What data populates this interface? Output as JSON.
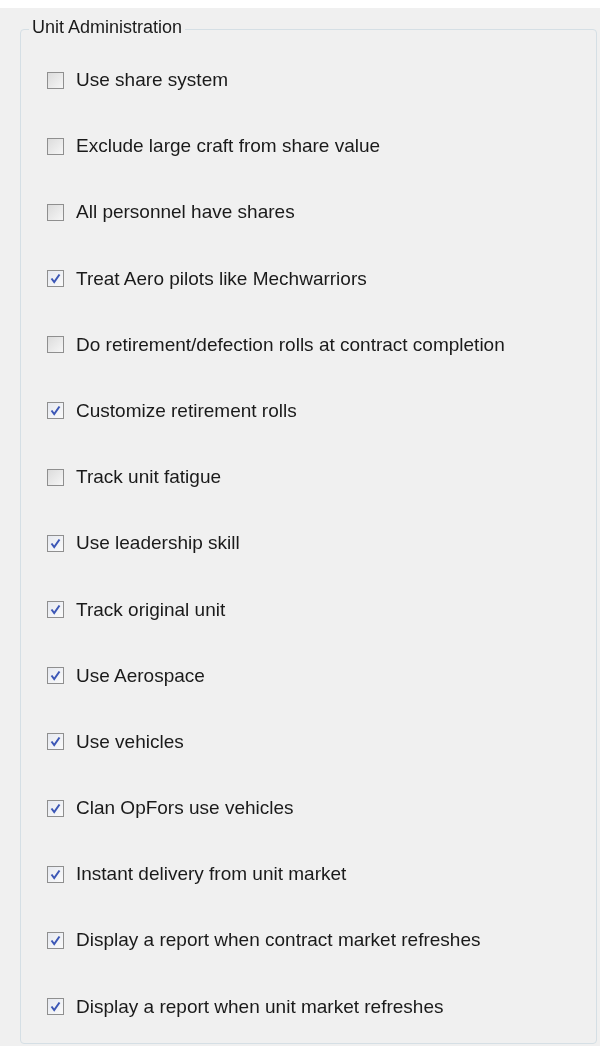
{
  "group": {
    "title": "Unit Administration",
    "options": [
      {
        "label": "Use share system",
        "checked": false
      },
      {
        "label": "Exclude large craft from share value",
        "checked": false
      },
      {
        "label": "All personnel have shares",
        "checked": false
      },
      {
        "label": "Treat Aero pilots like Mechwarriors",
        "checked": true
      },
      {
        "label": "Do retirement/defection rolls at contract completion",
        "checked": false
      },
      {
        "label": "Customize retirement rolls",
        "checked": true
      },
      {
        "label": "Track unit fatigue",
        "checked": false
      },
      {
        "label": "Use leadership skill",
        "checked": true
      },
      {
        "label": "Track original unit",
        "checked": true
      },
      {
        "label": "Use Aerospace",
        "checked": true
      },
      {
        "label": "Use vehicles",
        "checked": true
      },
      {
        "label": "Clan OpFors use vehicles",
        "checked": true
      },
      {
        "label": "Instant delivery from unit market",
        "checked": true
      },
      {
        "label": "Display a report when contract market refreshes",
        "checked": true
      },
      {
        "label": "Display a report when unit market refreshes",
        "checked": true
      }
    ]
  }
}
